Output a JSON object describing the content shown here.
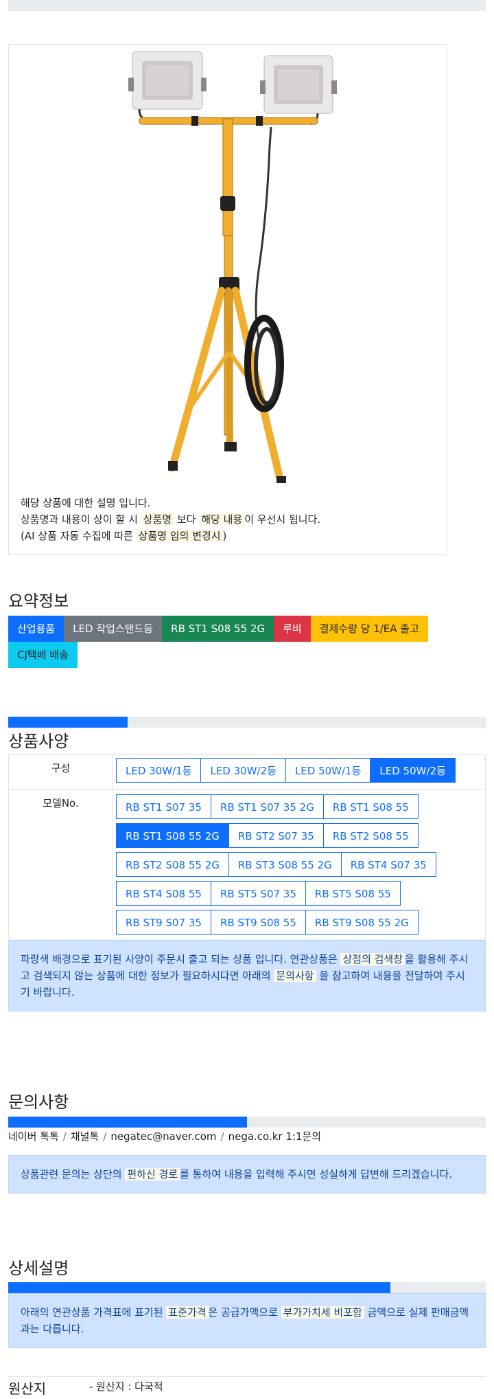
{
  "colors": {
    "primary": "#0d6efd",
    "secondary": "#6c757d",
    "success": "#198754",
    "danger": "#dc3545",
    "warning": "#ffc107",
    "info": "#0dcaf0",
    "alert_bg": "#cfe2ff"
  },
  "product": {
    "image_icon": "led-tripod-work-light-image",
    "desc_line1": "해당 상품에 대한 설명 입니다.",
    "desc_line2_a": "상품명과 내용이 상이 할 시",
    "desc_line2_mark1": "상품명",
    "desc_line2_b": "보다",
    "desc_line2_mark2": "해당 내용",
    "desc_line2_c": "이 우선시 됩니다.",
    "desc_line3_a": "(AI 상품 자동 수집에 따른",
    "desc_line3_mark": "상품명 임의 변경시",
    "desc_line3_b": ")"
  },
  "summary": {
    "title": "요약정보",
    "badges": [
      "산업용품",
      "LED 작업스탠드등",
      "RB ST1 S08 55 2G",
      "루비",
      "결제수량 당 1/EA 출고",
      "CJ택배 배송"
    ]
  },
  "spec": {
    "title": "상품사양",
    "progress": 0.25,
    "config_label": "구성",
    "config_options": [
      "LED 30W/1등",
      "LED 30W/2등",
      "LED 50W/1등",
      "LED 50W/2등"
    ],
    "config_selected": "LED 50W/2등",
    "model_label": "모델No.",
    "model_options": [
      [
        "RB ST1 S07 35",
        "RB ST1 S07 35 2G",
        "RB ST1 S08 55"
      ],
      [
        "RB ST1 S08 55 2G",
        "RB ST2 S07 35",
        "RB ST2 S08 55"
      ],
      [
        "RB ST2 S08 55 2G",
        "RB ST3 S08 55 2G",
        "RB ST4 S07 35"
      ],
      [
        "RB ST4 S08 55",
        "RB ST5 S07 35",
        "RB ST5 S08 55"
      ],
      [
        "RB ST9 S07 35",
        "RB ST9 S08 55",
        "RB ST9 S08 55 2G"
      ]
    ],
    "model_selected": "RB ST1 S08 55 2G",
    "notice_a": "파랑색 배경으로 표기된 사양이 주문시 출고 되는 상품 입니다. 연관상품은",
    "notice_mark1": "상점의 검색창",
    "notice_b": "을 활용해 주시고 검색되지 않는 상품에 대한 정보가 필요하시다면 아래의",
    "notice_mark2": "문의사항",
    "notice_c": "을 참고하여 내용을 전달하여 주시기 바랍니다."
  },
  "inquiry": {
    "title": "문의사항",
    "progress": 0.5,
    "channels": [
      "네이버 톡톡",
      "채널톡",
      "negatec@naver.com",
      "nega.co.kr 1:1문의"
    ],
    "separator": "/",
    "notice_a": "상품관련 문의는 상단의",
    "notice_mark": "편하신 경로",
    "notice_b": "를 통하여 내용을 입력해 주시면 성실하게 답변해 드리겠습니다."
  },
  "detail": {
    "title": "상세설명",
    "progress": 0.8,
    "notice_a": "아래의 연관상품 가격표에 표기된",
    "notice_mark1": "표준가격",
    "notice_b": "은 공급가액으로",
    "notice_mark2": "부가가치세 비포함",
    "notice_c": "금액으로 실제 판매금액과는 다릅니다."
  },
  "origin": {
    "title": "원산지",
    "value": "- 원산지 : 다국적"
  }
}
